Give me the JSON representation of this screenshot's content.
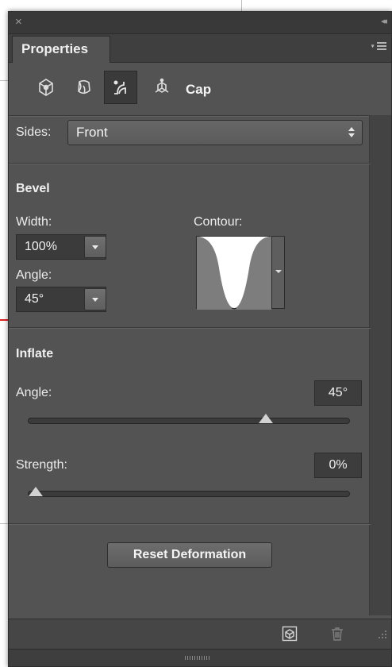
{
  "panel": {
    "close_glyph": "×",
    "collapse_glyph": "◂◂",
    "tab_label": "Properties",
    "menu_icon": "panel-menu-icon"
  },
  "toolbar": {
    "icons": [
      "3d-mesh-icon",
      "3d-deform-icon",
      "3d-cap-icon",
      "3d-coordinates-icon"
    ],
    "active_index": 2,
    "active_label": "Cap"
  },
  "sides": {
    "label": "Sides:",
    "value": "Front"
  },
  "bevel": {
    "title": "Bevel",
    "width_label": "Width:",
    "width_value": "100%",
    "angle_label": "Angle:",
    "angle_value": "45°",
    "contour_label": "Contour:"
  },
  "inflate": {
    "title": "Inflate",
    "angle_label": "Angle:",
    "angle_value": "45°",
    "angle_slider_fraction": 0.75,
    "strength_label": "Strength:",
    "strength_value": "0%",
    "strength_slider_fraction": 0.0
  },
  "reset_button_label": "Reset Deformation",
  "bottom_icons": [
    "render-icon",
    "trash-icon"
  ],
  "colors": {
    "panel_bg": "#535353",
    "field_bg": "#3b3b3b",
    "accent_guide": "#e02020"
  }
}
